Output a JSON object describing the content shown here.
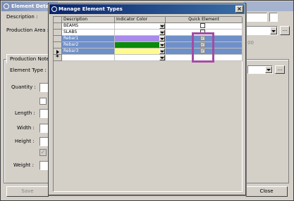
{
  "background": {
    "title": "Element Deta",
    "labels": {
      "description": "Description :",
      "production_area": "Production Area :",
      "tab": "Production Notes",
      "element_type": "Element Type :",
      "quantity": "Quantity :",
      "length": "Length :",
      "width": "Width :",
      "height": "Height :",
      "weight": "Weight :",
      "right_value": "00"
    },
    "buttons": {
      "save": "Save",
      "close": "Close",
      "ellipsis": "..."
    }
  },
  "dialog": {
    "title": "Manage Element Types",
    "close_glyph": "×",
    "columns": [
      "Description",
      "Indicator Color",
      "Quick Element"
    ],
    "rows": [
      {
        "description": "BEAMS",
        "color": "#ffffff",
        "quick_element": false,
        "highlighted": false,
        "indicator": ""
      },
      {
        "description": "SLABS",
        "color": "#ffffff",
        "quick_element": false,
        "highlighted": false,
        "indicator": ""
      },
      {
        "description": "Rebar1",
        "color": "#a98bea",
        "quick_element": true,
        "highlighted": true,
        "indicator": ""
      },
      {
        "description": "Rebar2",
        "color": "#0b8a0b",
        "quick_element": true,
        "highlighted": true,
        "indicator": ""
      },
      {
        "description": "Rebar3",
        "color": "#fdfb8a",
        "quick_element": true,
        "highlighted": true,
        "indicator": "current"
      },
      {
        "description": "",
        "color": "#ffffff",
        "quick_element": false,
        "highlighted": false,
        "indicator": "new"
      }
    ]
  },
  "colors": {
    "selection_highlight": "#6f8fc9",
    "annotation": "#a44ca4",
    "title_active": "#0a246a"
  }
}
